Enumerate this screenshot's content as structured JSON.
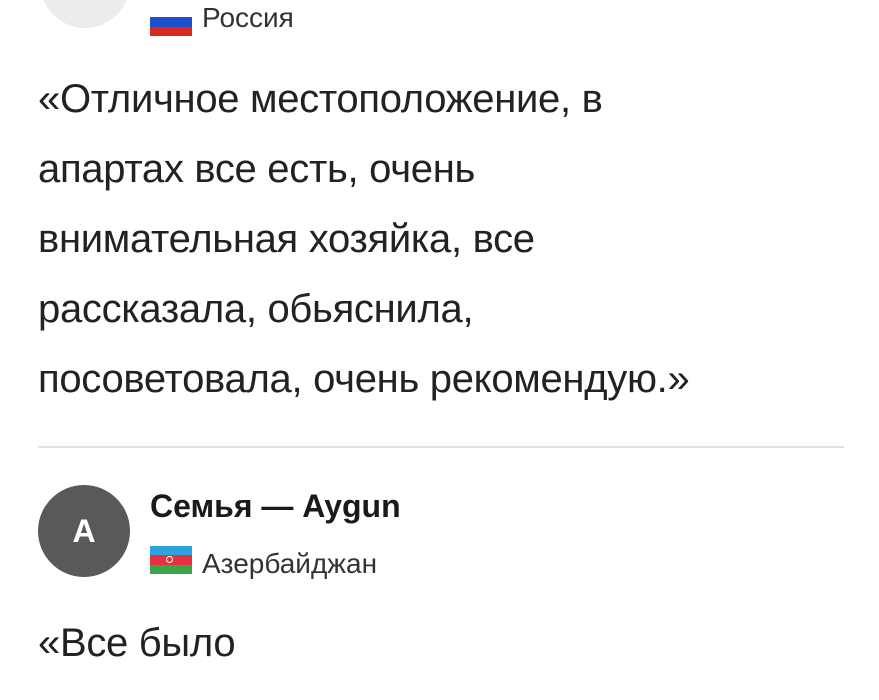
{
  "review_1": {
    "country": "Россия",
    "text": "«Отличное местоположение, в апартах все есть, очень внимательная хозяйка, все рассказала, обьяснила, посоветовала, очень рекомендую.»",
    "lines": [
      "«Отличное местоположение, в",
      "апартах все есть, очень",
      "внимательная хозяйка, все",
      "рассказала, обьяснила,",
      "посоветовала, очень рекомендую.»"
    ],
    "flag_colors": [
      "#ffffff",
      "#1c4fd0",
      "#d52b1e"
    ]
  },
  "review_2": {
    "avatar_letter": "A",
    "reviewer_name": "Семья — Aygun",
    "country": "Азербайджан",
    "text_start": "«Все было",
    "flag_colors": [
      "#2fa3dd",
      "#e8313f",
      "#3aa448"
    ]
  },
  "colors": {
    "avatar_bg": "#595959",
    "divider": "#e3e3e3",
    "text": "#222222"
  }
}
